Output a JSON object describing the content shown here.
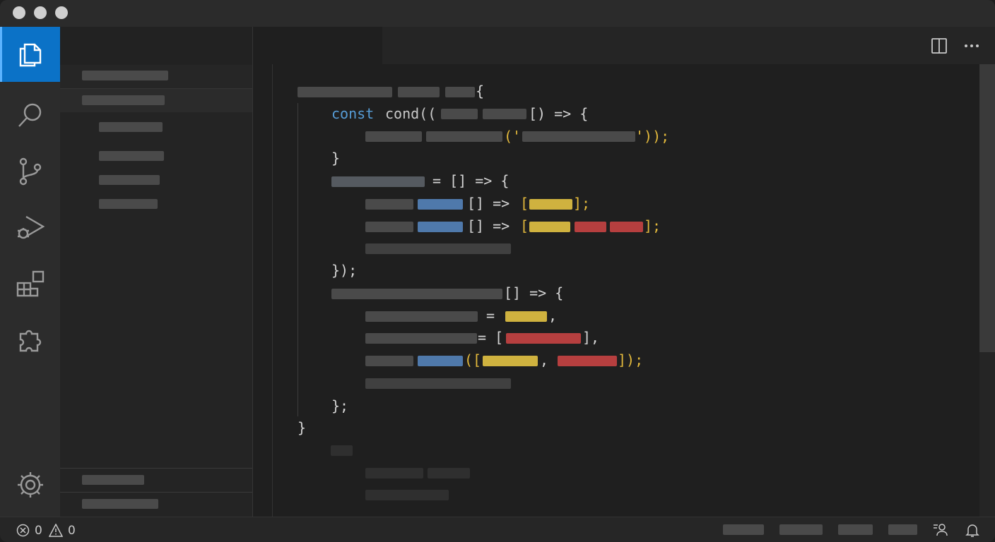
{
  "editor": {
    "line2": {
      "kw": "const",
      "fn": "cond((",
      "tail": "[) => {"
    },
    "arrow": "=>",
    "open_brace": "{",
    "close_brace": "}",
    "close_paren_semi": "});",
    "close_brace_semi": "};",
    "eq_empty_arrow": "= [] => {",
    "empty_arrow": "[] =>",
    "bracket_open": "[",
    "bracket_close_semi": "];",
    "paren_quote_open": "('",
    "quote_paren_close": "'));",
    "eq": "=",
    "comma": ",",
    "eq_bracket": "= [",
    "bracket_close_comma": "],",
    "paren_bracket_open": "([",
    "bracket_paren_close": "]);",
    "empty_arrow_brace": "[] => {"
  },
  "status": {
    "errors": "0",
    "warnings": "0"
  },
  "colors": {
    "accent": "#0b72c7",
    "keyword": "#569cd6",
    "yellow": "#cfb23f",
    "red": "#b63f3f",
    "blue": "#4f79ab"
  }
}
